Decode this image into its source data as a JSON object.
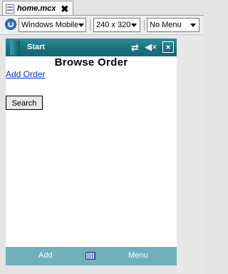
{
  "editor": {
    "tab_title": "home.mcx"
  },
  "toolbar": {
    "platform": "Windows Mobile",
    "resolution": "240 x 320",
    "menu_mode": "No Menu"
  },
  "device": {
    "titlebar": {
      "start_label": "Start",
      "connectivity_icon": "⇄",
      "volume_icon": "◀×",
      "close_icon": "×"
    },
    "page_heading": "Browse Order",
    "add_order_link": "Add Order",
    "search_button": "Search",
    "softkeys": {
      "left": "Add",
      "right": "Menu"
    }
  },
  "colors": {
    "titlebar": "#1b6f7c",
    "softkey_bar": "#6fb0bc",
    "link": "#0033cc"
  }
}
